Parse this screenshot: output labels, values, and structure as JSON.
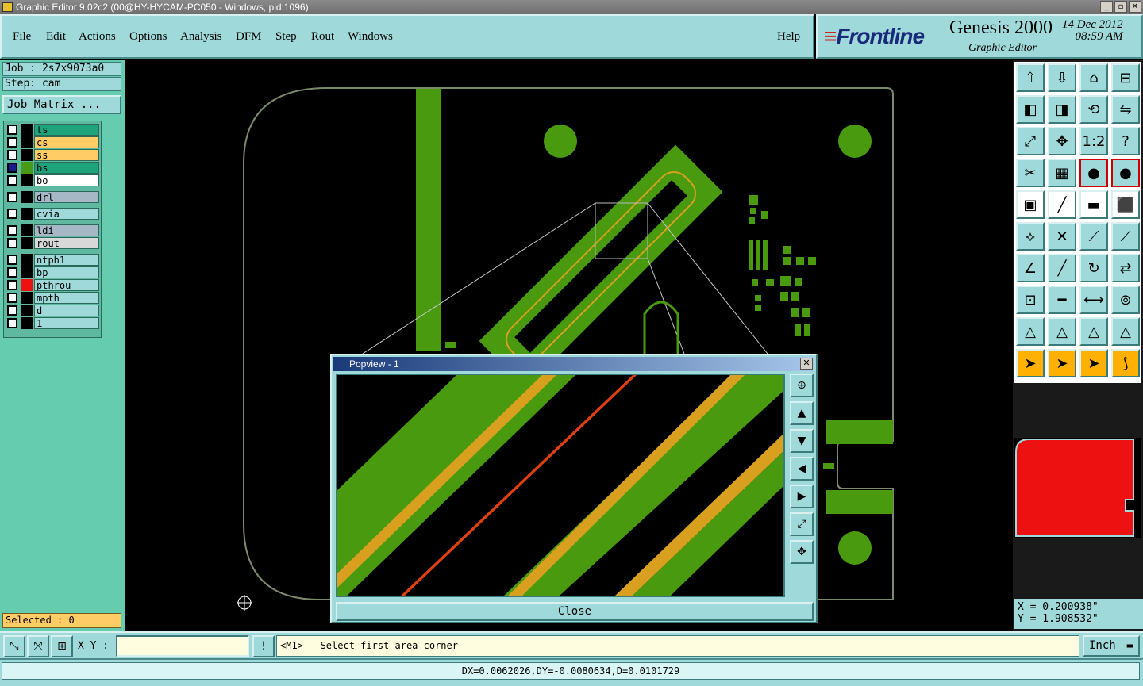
{
  "window": {
    "title": "Graphic Editor 9.02c2 (00@HY-HYCAM-PC050 - Windows, pid:1096)",
    "min": "_",
    "max": "▫",
    "close": "✕"
  },
  "menu": [
    "File",
    "Edit",
    "Actions",
    "Options",
    "Analysis",
    "DFM",
    "Step",
    "Rout",
    "Windows"
  ],
  "help": "Help",
  "brand": {
    "logo": "Frontline",
    "product": "Genesis 2000",
    "subtitle": "Graphic Editor",
    "date": "14 Dec 2012",
    "time": "08:59 AM"
  },
  "job": {
    "job_line": "Job : 2s7x9073a0",
    "step_line": "Step: cam",
    "matrix_button": "Job Matrix ..."
  },
  "layers": [
    {
      "name": "ts",
      "color": "#1fa37a",
      "swatch": "#000000"
    },
    {
      "name": "cs",
      "color": "#ffcc66",
      "swatch": "#000000"
    },
    {
      "name": "ss",
      "color": "#ffcc66",
      "swatch": "#000000"
    },
    {
      "name": "bs",
      "color": "#1fa37a",
      "swatch": "#4a9a1a"
    },
    {
      "name": "bo",
      "color": "#ffffff",
      "swatch": "#000000"
    },
    {
      "name": "drl",
      "color": "#a6b8c6",
      "swatch": "#000000"
    },
    {
      "name": "cvia",
      "color": "#9fd9d9",
      "swatch": "#000000"
    },
    {
      "name": "ldi",
      "color": "#a6b8c6",
      "swatch": "#000000"
    },
    {
      "name": "rout",
      "color": "#d8d8d8",
      "swatch": "#000000"
    },
    {
      "name": "ntph1",
      "color": "#9fd9d9",
      "swatch": "#000000"
    },
    {
      "name": "bp",
      "color": "#9fd9d9",
      "swatch": "#000000"
    },
    {
      "name": "pthrou",
      "color": "#9fd9d9",
      "swatch": "#ee1111"
    },
    {
      "name": "mpth",
      "color": "#9fd9d9",
      "swatch": "#000000"
    },
    {
      "name": "d",
      "color": "#9fd9d9",
      "swatch": "#000000"
    },
    {
      "name": "1",
      "color": "#9fd9d9",
      "swatch": "#000000"
    }
  ],
  "selected": "Selected : 0",
  "popview": {
    "title": "Popview - 1",
    "close": "Close"
  },
  "coords": {
    "x": "X = 0.200938\"",
    "y": "Y = 1.908532\""
  },
  "bottom": {
    "xy_label": "X Y :",
    "xy_value": "",
    "info": "!",
    "prompt": "<M1> - Select first area corner",
    "unit": "Inch"
  },
  "status": "DX=0.0062026,DY=-0.0080634,D=0.0101729",
  "colors": {
    "board_green": "#4a9a10",
    "outline": "#7a8a6a",
    "gold": "#d9a020"
  },
  "icons": {
    "tool_grid": [
      "measure-up-icon",
      "measure-down-icon",
      "home-icon",
      "layout-icon",
      "pan-left-icon",
      "pan-right-icon",
      "rotate-icon",
      "mirror-icon",
      "zoom-fit-icon",
      "zoom-center-icon",
      "scale-1to2-icon",
      "help-icon",
      "snap-icon",
      "grid-icon",
      "traffic-light-icon",
      "traffic-light-red-icon",
      "feature-icon",
      "line-icon",
      "ruler-icon",
      "pad-icon",
      "connect-icon",
      "intersect-icon",
      "node-icon",
      "edge-icon",
      "angle-icon",
      "slope-icon",
      "arc-icon",
      "text-icon",
      "point-icon",
      "segment-icon",
      "dimension-icon",
      "cluster-icon",
      "triangle-icon",
      "triangle-b-icon",
      "triangle-c-icon",
      "triangle-d-icon",
      "pointer-icon",
      "pointer-box-icon",
      "pointer-fill-icon",
      "pointer-chain-icon"
    ]
  }
}
